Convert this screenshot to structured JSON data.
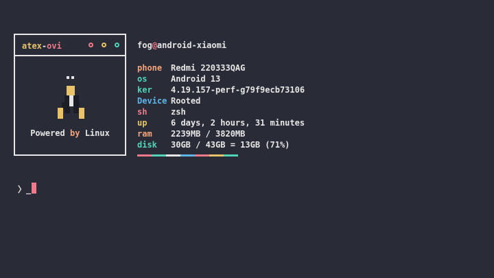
{
  "window": {
    "title_part1": "atex",
    "title_sep": "-",
    "title_part2": "ovi",
    "controls": [
      "close-dot",
      "minimize-dot",
      "maximize-dot"
    ]
  },
  "logo": {
    "icon": "tux-penguin-icon",
    "powered_pre": "Powered",
    "powered_by": "by",
    "powered_post": "Linux"
  },
  "header": {
    "user": "fog",
    "at": "@",
    "host": "android-xiaomi"
  },
  "info": [
    {
      "key": "phone",
      "value": "Redmi 220333QAG",
      "color": "#f4a37a"
    },
    {
      "key": "os",
      "value": "Android 13",
      "color": "#52d3b6"
    },
    {
      "key": "ker",
      "value": "4.19.157-perf-g79f9ecb73106",
      "color": "#52d3b6"
    },
    {
      "key": "Device",
      "value": "Rooted",
      "color": "#5fb4e8"
    },
    {
      "key": "sh",
      "value": "zsh",
      "color": "#f07a8a"
    },
    {
      "key": "up",
      "value": "6 days, 2 hours, 31 minutes",
      "color": "#e8c36a"
    },
    {
      "key": "ram",
      "value": "2239MB / 3820MB",
      "color": "#f4a37a"
    },
    {
      "key": "disk",
      "value": "30GB / 43GB = 13GB (71%)",
      "color": "#52d3b6"
    }
  ],
  "palette": [
    "#f07a8a",
    "#52d3b6",
    "#e6e6e6",
    "#5fb4e8",
    "#f07a8a",
    "#e8c36a",
    "#52d3b6"
  ],
  "prompt": {
    "symbol": "〉_"
  }
}
